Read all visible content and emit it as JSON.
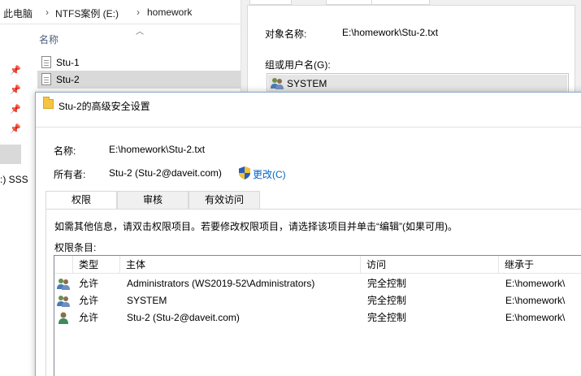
{
  "explorer": {
    "breadcrumb": [
      "此电脑",
      "NTFS案例 (E:)",
      "homework"
    ],
    "breadcrumb_sep": "›",
    "column_header": "名称",
    "files": [
      {
        "name": "Stu-1",
        "selected": false
      },
      {
        "name": "Stu-2",
        "selected": true
      }
    ],
    "nav_partial_text": ":) SSS"
  },
  "properties": {
    "object_name_label": "对象名称:",
    "object_name_value": "E:\\homework\\Stu-2.txt",
    "group_label": "组或用户名(G):",
    "users": [
      "SYSTEM"
    ]
  },
  "advanced": {
    "title": "Stu-2的高级安全设置",
    "name_label": "名称:",
    "name_value": "E:\\homework\\Stu-2.txt",
    "owner_label": "所有者:",
    "owner_value": "Stu-2 (Stu-2@daveit.com)",
    "change_link": "更改(C)",
    "tabs": [
      "权限",
      "审核",
      "有效访问"
    ],
    "active_tab": 0,
    "info_text": "如需其他信息，请双击权限项目。若要修改权限项目，请选择该项目并单击“编辑”(如果可用)。",
    "entries_label": "权限条目:",
    "columns": [
      "类型",
      "主体",
      "访问",
      "继承于"
    ],
    "entries": [
      {
        "type": "允许",
        "principal": "Administrators (WS2019-52\\Administrators)",
        "access": "完全控制",
        "inherited": "E:\\homework\\",
        "icon": "group-icon"
      },
      {
        "type": "允许",
        "principal": "SYSTEM",
        "access": "完全控制",
        "inherited": "E:\\homework\\",
        "icon": "group-icon"
      },
      {
        "type": "允许",
        "principal": "Stu-2 (Stu-2@daveit.com)",
        "access": "完全控制",
        "inherited": "E:\\homework\\",
        "icon": "user-icon"
      }
    ]
  },
  "colors": {
    "link": "#0066cc",
    "selection": "#d9d9d9",
    "dialog_border": "#8aa8c8"
  }
}
